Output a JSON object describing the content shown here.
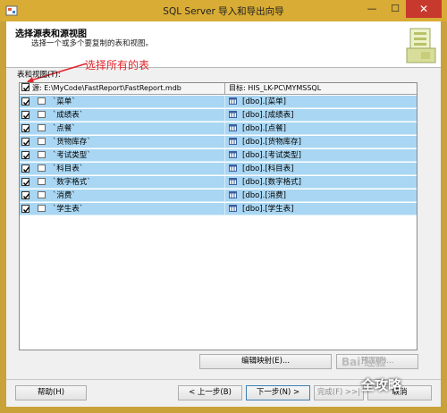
{
  "window": {
    "title": "SQL Server 导入和导出向导",
    "minimize_glyph": "—",
    "maximize_glyph": "☐",
    "close_glyph": "✕"
  },
  "header": {
    "title": "选择源表和源视图",
    "subtitle": "选择一个或多个要复制的表和视图。"
  },
  "annotation": "选择所有的表",
  "group_label": "表和视图(T):",
  "grid": {
    "col_source": "源: E:\\MyCode\\FastReport\\FastReport.mdb",
    "col_dest": "目标: HIS_LK-PC\\MYMSSQL",
    "rows": [
      {
        "source": "`菜单`",
        "dest": "[dbo].[菜单]"
      },
      {
        "source": "`成绩表`",
        "dest": "[dbo].[成绩表]"
      },
      {
        "source": "`点餐`",
        "dest": "[dbo].[点餐]"
      },
      {
        "source": "`货物库存`",
        "dest": "[dbo].[货物库存]"
      },
      {
        "source": "`考试类型`",
        "dest": "[dbo].[考试类型]"
      },
      {
        "source": "`科目表`",
        "dest": "[dbo].[科目表]"
      },
      {
        "source": "`数字格式`",
        "dest": "[dbo].[数字格式]"
      },
      {
        "source": "`消费`",
        "dest": "[dbo].[消费]"
      },
      {
        "source": "`学生表`",
        "dest": "[dbo].[学生表]"
      }
    ]
  },
  "buttons": {
    "edit_mappings": "编辑映射(E)...",
    "preview": "预览(P)...",
    "help": "帮助(H)",
    "back": "< 上一步(B)",
    "next": "下一步(N) >",
    "finish": "完成(F) >>|",
    "cancel": "取消"
  },
  "watermark": {
    "logo": "Bai 经验",
    "text": "全攻略"
  },
  "colors": {
    "title_bar": "#d8ac35",
    "row_selected": "#a9d6f2",
    "annotation": "#e2252a",
    "close_button": "#c7392c"
  }
}
